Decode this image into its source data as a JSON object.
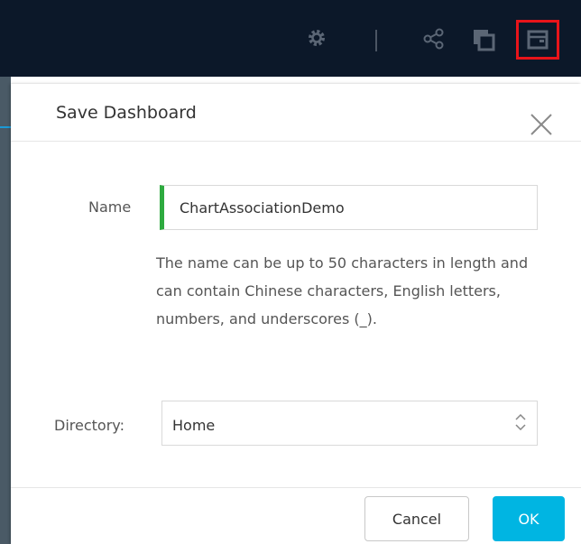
{
  "toolbar": {
    "icons": [
      "gear-icon",
      "share-icon",
      "copy-icon",
      "save-icon"
    ],
    "highlight_color": "#e8141a",
    "background_color": "#0c1829"
  },
  "dialog": {
    "title": "Save Dashboard",
    "name_label": "Name",
    "name_value": "ChartAssociationDemo",
    "name_hint": "The name can be up to 50 characters in length and can contain Chinese characters, English letters, numbers, and underscores (_).",
    "directory_label": "Directory:",
    "directory_value": "Home",
    "cancel_label": "Cancel",
    "ok_label": "OK",
    "input_accent_color": "#2eaa3f",
    "ok_color": "#00b5e2"
  }
}
